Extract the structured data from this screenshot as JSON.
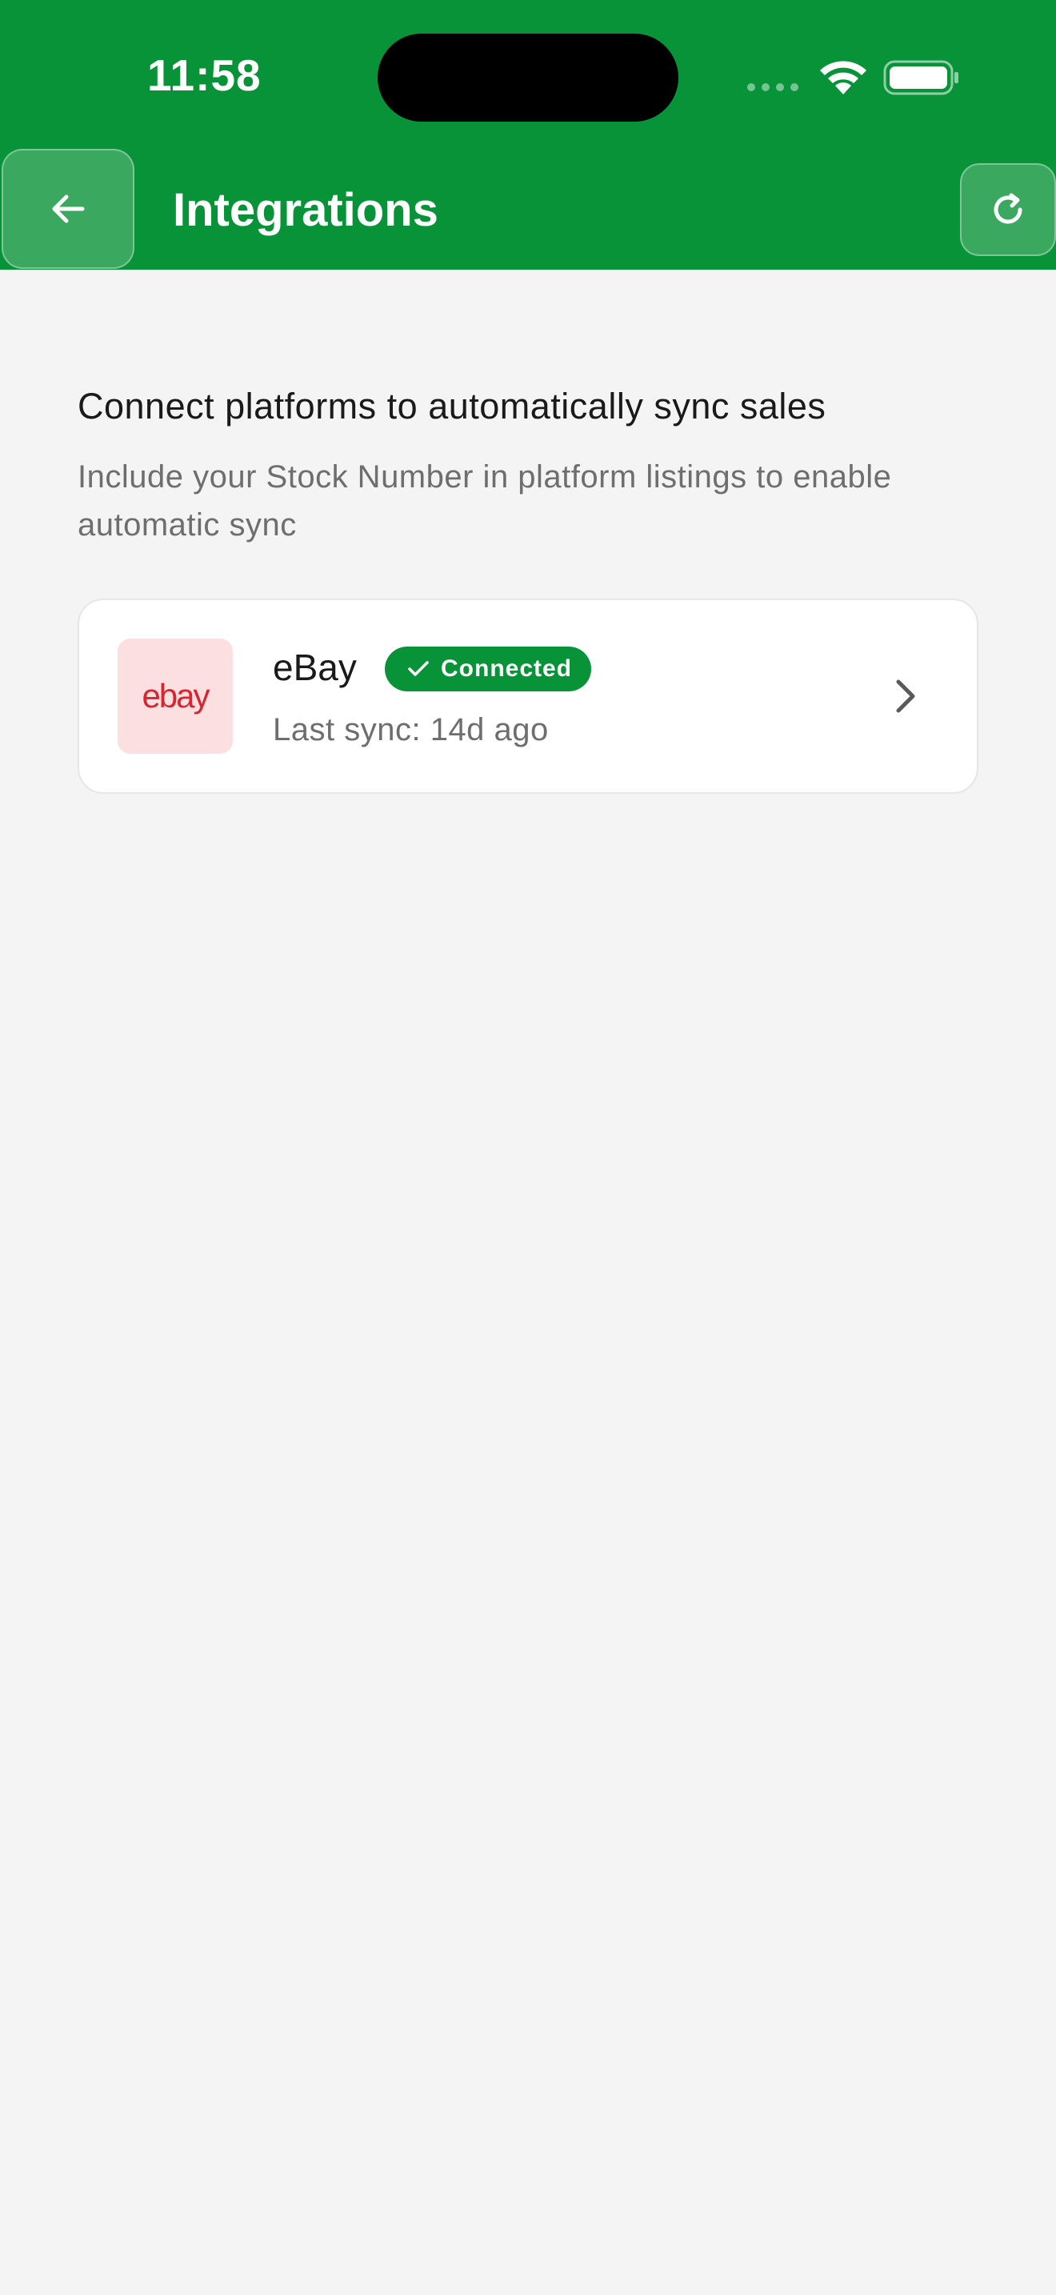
{
  "status_bar": {
    "time": "11:58",
    "icons": [
      "signal-icon",
      "wifi-icon",
      "battery-icon"
    ]
  },
  "header": {
    "title": "Integrations",
    "back_icon": "arrow-left-icon",
    "refresh_icon": "refresh-icon",
    "background_color": "#099338"
  },
  "intro": {
    "heading": "Connect platforms to automatically sync sales",
    "subtext": "Include your Stock Number in platform listings to enable automatic sync"
  },
  "integrations": [
    {
      "logo_text": "ebay",
      "name": "eBay",
      "status": "Connected",
      "status_icon": "check-icon",
      "last_sync": "Last sync: 14d ago",
      "accent_color": "#d7262f",
      "badge_color": "#099338"
    }
  ]
}
